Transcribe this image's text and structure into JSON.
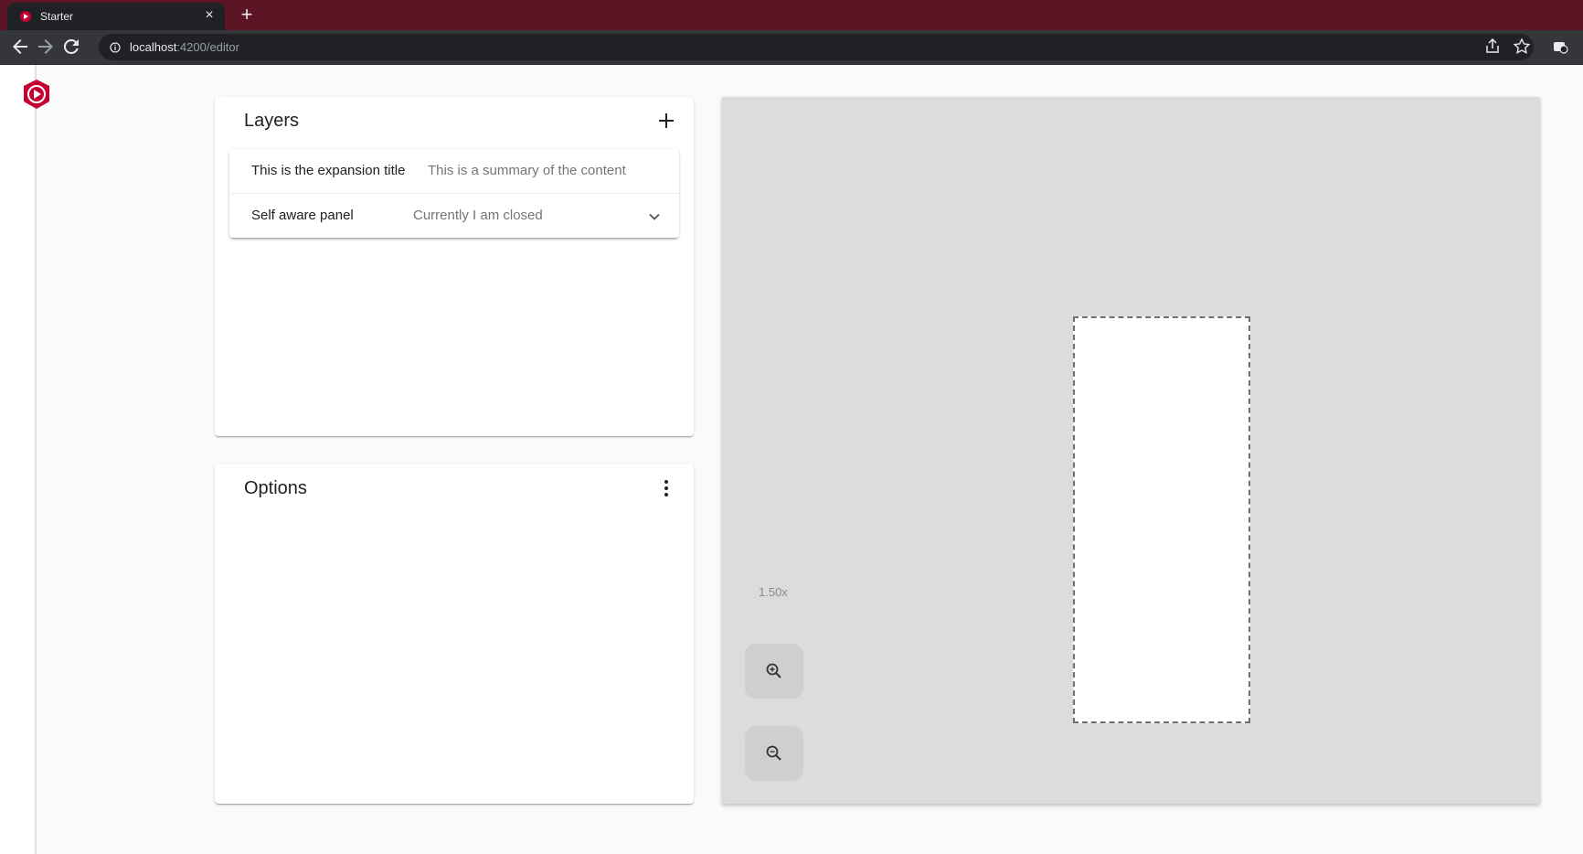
{
  "browser": {
    "tab_title": "Starter",
    "tab_close": "×",
    "new_tab": "+",
    "url_host": "localhost",
    "url_path": ":4200/editor"
  },
  "layers": {
    "title": "Layers",
    "add_icon": "plus-icon",
    "panels": [
      {
        "title": "This is the expansion title",
        "description": "This is a summary of the content"
      },
      {
        "title": "Self aware panel",
        "description": "Currently I am closed"
      }
    ]
  },
  "options": {
    "title": "Options",
    "menu_icon": "more-vert-icon"
  },
  "canvas": {
    "zoom_label": "1.50x",
    "zoom_in_icon": "zoom-in-icon",
    "zoom_out_icon": "zoom-out-icon"
  },
  "colors": {
    "accent": "#c3002f",
    "tabbar": "#5c1525",
    "canvas_bg": "#dcdcdc"
  }
}
